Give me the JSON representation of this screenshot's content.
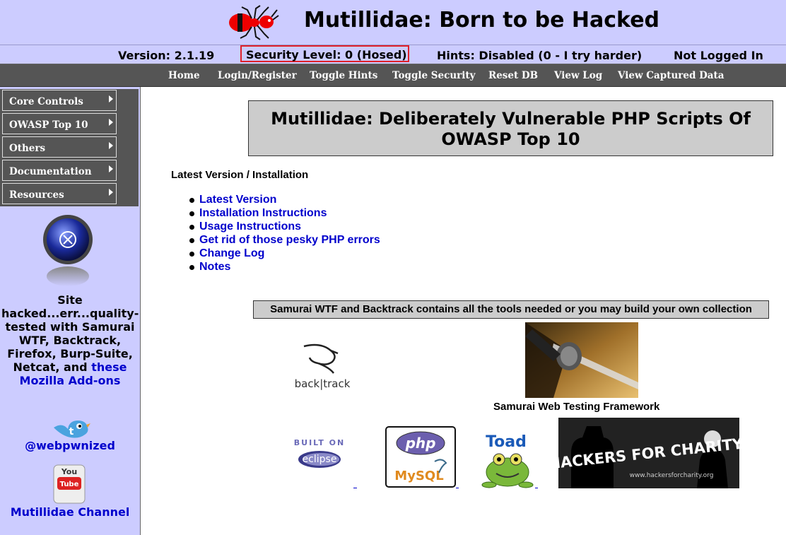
{
  "header": {
    "title": "Mutillidae: Born to be Hacked"
  },
  "status": {
    "version": "Version: 2.1.19",
    "security": "Security Level: 0 (Hosed)",
    "hints": "Hints: Disabled (0 - I try harder)",
    "login": "Not Logged In",
    "highlight_color": "#e0202a"
  },
  "menu": [
    "Home",
    "Login/Register",
    "Toggle Hints",
    "Toggle Security",
    "Reset DB",
    "View Log",
    "View Captured Data"
  ],
  "sidebar": {
    "items": [
      "Core Controls",
      "OWASP Top 10",
      "Others",
      "Documentation",
      "Resources"
    ],
    "site_text": "Site hacked...err...quality-tested with Samurai WTF, Backtrack, Firefox, Burp-Suite, Netcat, and",
    "site_link": "these Mozilla Add-ons",
    "twitter": "@webpwnized",
    "youtube": "Mutillidae Channel"
  },
  "main": {
    "title": "Mutillidae: Deliberately Vulnerable PHP Scripts Of OWASP Top 10",
    "install_heading": "Latest Version / Installation",
    "links": [
      "Latest Version",
      "Installation Instructions",
      "Usage Instructions",
      "Get rid of those pesky PHP errors",
      "Change Log",
      "Notes"
    ],
    "tools_text": "Samurai WTF and Backtrack contains all the tools needed or you may build your own collection",
    "samurai_caption": "Samurai Web Testing Framework",
    "logos": {
      "backtrack": "back|track",
      "eclipse_top": "BUILT ON",
      "eclipse_bottom": "eclipse",
      "php": "php",
      "mysql": "MySQL",
      "toad": "Toad",
      "hfc": "HACKERS FOR CHARITY",
      "hfc_url": "www.hackersforcharity.org",
      "youtube_you": "You",
      "youtube_tube": "Tube"
    }
  },
  "colors": {
    "header_bg": "#ccccff",
    "menu_bg": "#555555",
    "link": "#0000cc"
  }
}
